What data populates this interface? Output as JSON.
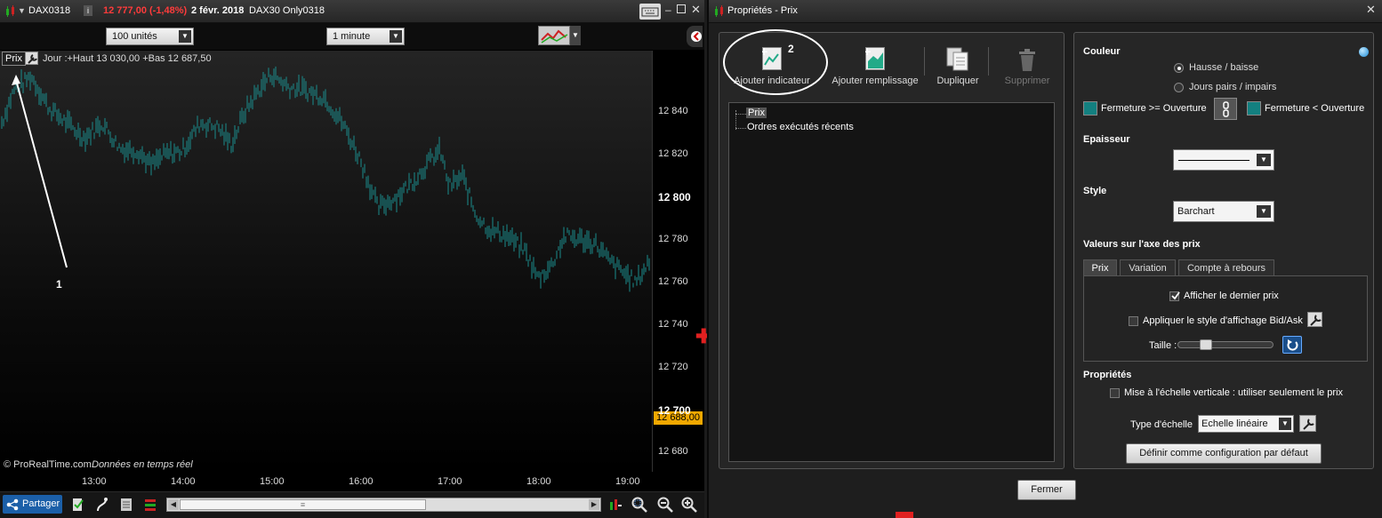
{
  "chart_window": {
    "symbol": "DAX0318",
    "info_label": "i",
    "price_change": "12 777,00 (-1,48%)",
    "date": "2 févr. 2018",
    "instrument": "DAX30 Only0318",
    "units_select": "100 unités",
    "timeframe_select": "1 minute",
    "series_label": "Prix",
    "series_info": "Jour :+Haut 13 030,00 +Bas 12 687,50",
    "copyright": "© ProRealTime.com",
    "realtime_note": "Données en temps réel",
    "last_price_tag": "12 688,00",
    "annotation_1": "1",
    "share_button": "Partager",
    "scroll_grip": "≡",
    "add_price_mark": "✚"
  },
  "chart_data": {
    "type": "bar",
    "ylim": [
      12671,
      12869
    ],
    "y_ticks": [
      {
        "label": "12 840",
        "value": 12840,
        "bold": false
      },
      {
        "label": "12 820",
        "value": 12820,
        "bold": false
      },
      {
        "label": "12 800",
        "value": 12800,
        "bold": true
      },
      {
        "label": "12 780",
        "value": 12780,
        "bold": false
      },
      {
        "label": "12 760",
        "value": 12760,
        "bold": false
      },
      {
        "label": "12 740",
        "value": 12740,
        "bold": false
      },
      {
        "label": "12 720",
        "value": 12720,
        "bold": false
      },
      {
        "label": "12 700",
        "value": 12700,
        "bold": true
      },
      {
        "label": "12 680",
        "value": 12680,
        "bold": false
      }
    ],
    "x_ticks": [
      "13:00",
      "14:00",
      "15:00",
      "16:00",
      "17:00",
      "18:00",
      "19:00"
    ],
    "anchors": [
      [
        0,
        12833
      ],
      [
        15,
        12850
      ],
      [
        35,
        12857
      ],
      [
        55,
        12842
      ],
      [
        75,
        12835
      ],
      [
        95,
        12828
      ],
      [
        115,
        12835
      ],
      [
        135,
        12823
      ],
      [
        155,
        12822
      ],
      [
        170,
        12815
      ],
      [
        185,
        12820
      ],
      [
        205,
        12822
      ],
      [
        225,
        12835
      ],
      [
        245,
        12833
      ],
      [
        260,
        12825
      ],
      [
        275,
        12840
      ],
      [
        290,
        12850
      ],
      [
        305,
        12858
      ],
      [
        325,
        12852
      ],
      [
        345,
        12850
      ],
      [
        365,
        12847
      ],
      [
        385,
        12835
      ],
      [
        405,
        12818
      ],
      [
        425,
        12795
      ],
      [
        445,
        12800
      ],
      [
        465,
        12808
      ],
      [
        485,
        12818
      ],
      [
        495,
        12822
      ],
      [
        505,
        12805
      ],
      [
        520,
        12810
      ],
      [
        535,
        12792
      ],
      [
        550,
        12785
      ],
      [
        570,
        12782
      ],
      [
        590,
        12775
      ],
      [
        605,
        12762
      ],
      [
        620,
        12768
      ],
      [
        635,
        12782
      ],
      [
        655,
        12780
      ],
      [
        670,
        12778
      ],
      [
        685,
        12770
      ],
      [
        700,
        12765
      ],
      [
        715,
        12760
      ],
      [
        730,
        12770
      ]
    ],
    "bar_color": "#1a8c8c"
  },
  "properties_window": {
    "title": "Propriétés - Prix",
    "toolbar": {
      "add_indicator": "Ajouter indicateur",
      "add_fill": "Ajouter remplissage",
      "duplicate": "Dupliquer",
      "delete": "Supprimer",
      "annotation_2": "2"
    },
    "tree": [
      "Prix",
      "Ordres exécutés récents"
    ],
    "color_section": {
      "title": "Couleur",
      "option_updown": "Hausse / baisse",
      "option_evenodd": "Jours pairs / impairs",
      "close_ge_open": "Fermeture >= Ouverture",
      "close_lt_open": "Fermeture  < Ouverture",
      "swatch_color": "#138080"
    },
    "thickness_label": "Epaisseur",
    "style_label": "Style",
    "style_value": "Barchart",
    "price_axis_values_label": "Valeurs sur l'axe des prix",
    "tabs": [
      "Prix",
      "Variation",
      "Compte à rebours"
    ],
    "show_last_price": "Afficher le dernier prix",
    "apply_bid_ask": "Appliquer le style d'affichage Bid/Ask",
    "size_label": "Taille :",
    "properties_label": "Propriétés",
    "vertical_scaling": "Mise à l'échelle verticale : utiliser seulement le prix",
    "scale_type_label": "Type d'échelle",
    "scale_type_value": "Echelle linéaire",
    "default_config_button": "Définir comme configuration par défaut",
    "close_button": "Fermer"
  }
}
